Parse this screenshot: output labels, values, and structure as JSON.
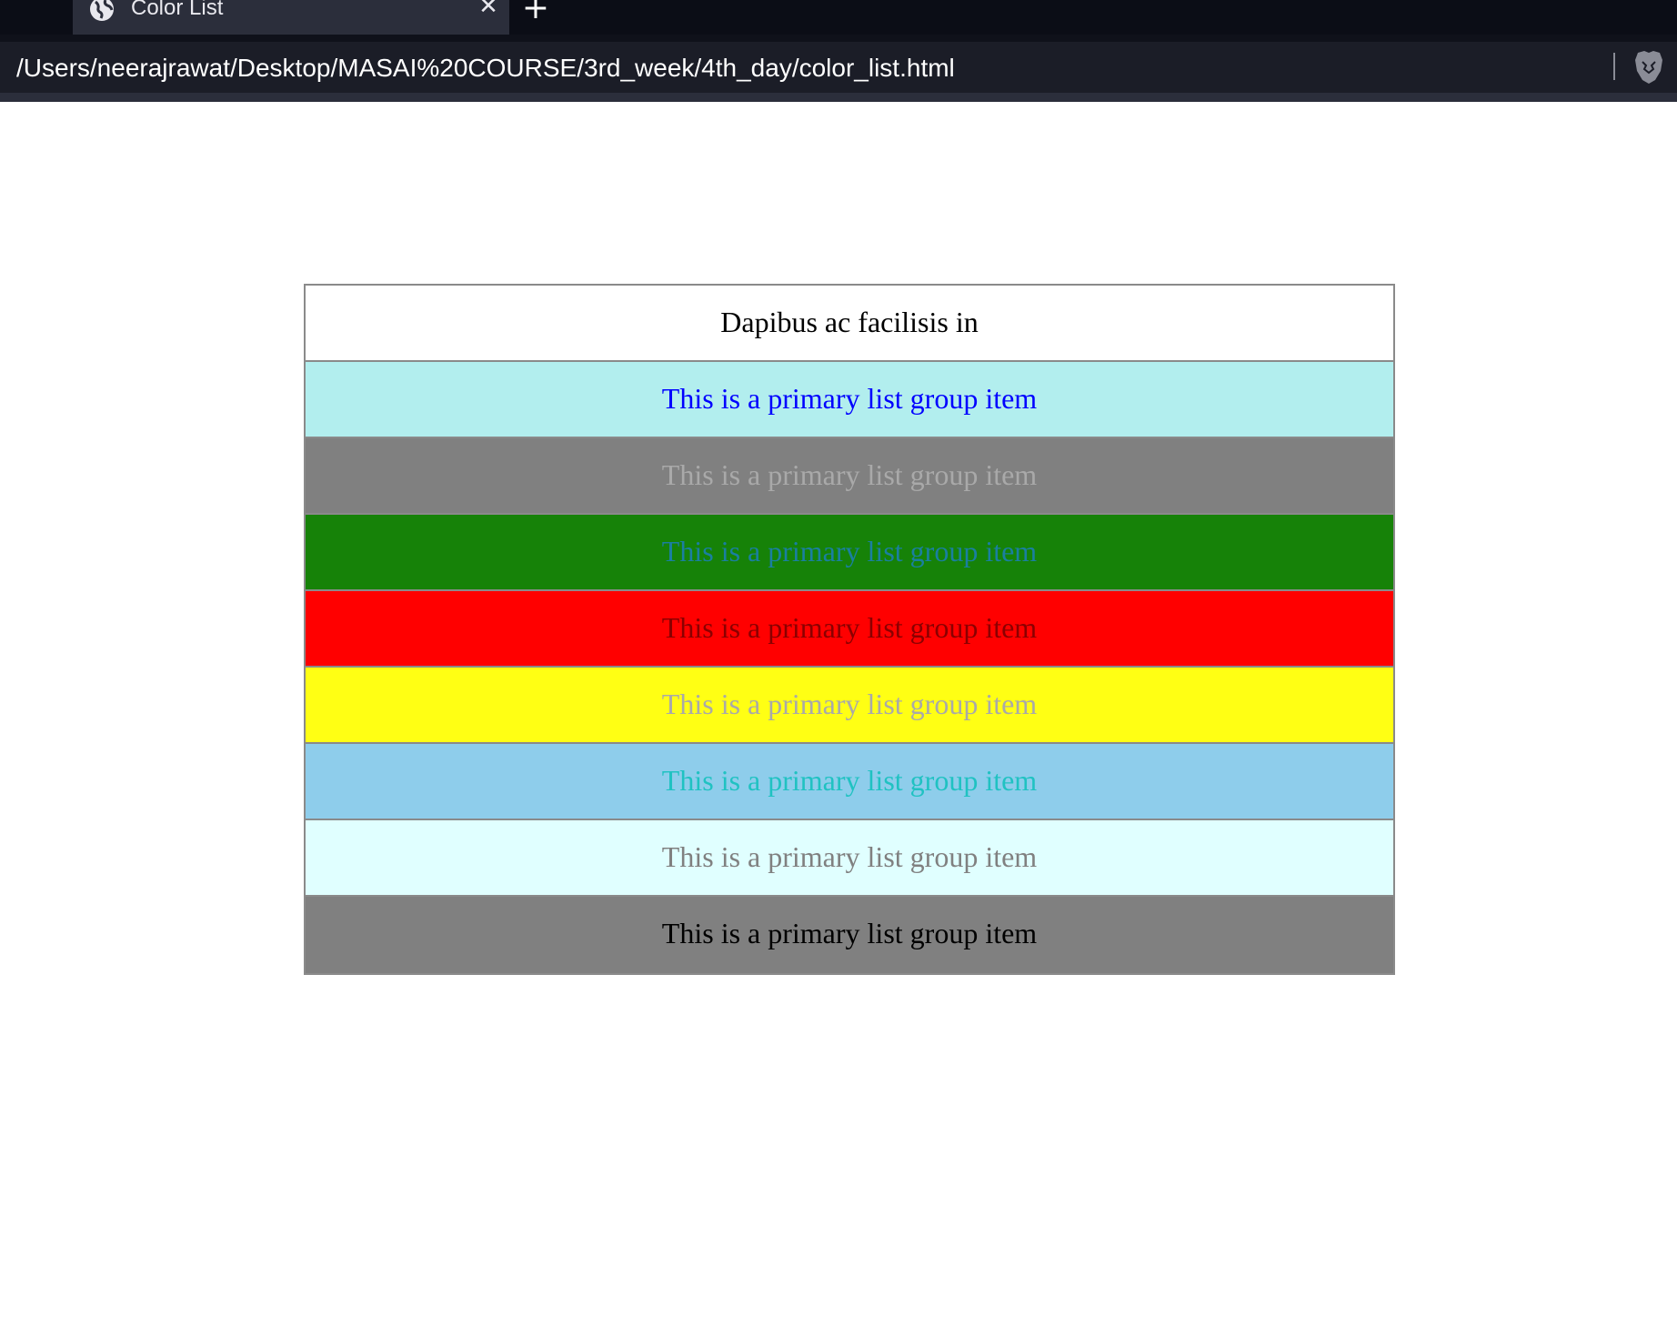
{
  "browser": {
    "tab_title": "Color List",
    "close_symbol": "✕",
    "new_tab_symbol": "+",
    "url": "/Users/neerajrawat/Desktop/MASAI%20COURSE/3rd_week/4th_day/color_list.html",
    "icons": [
      "globe-icon",
      "close-icon",
      "plus-icon",
      "brave-lion-icon"
    ]
  },
  "list": {
    "header": {
      "text": "Dapibus ac facilisis in",
      "bg": "#ffffff",
      "color": "#000000"
    },
    "items": [
      {
        "text": "This is a primary list group item",
        "bg": "#b2eeee",
        "color": "#0000ff"
      },
      {
        "text": "This is a primary list group item",
        "bg": "#808080",
        "color": "#a9a9a9"
      },
      {
        "text": "This is a primary list group item",
        "bg": "#168208",
        "color": "#1a7fa0"
      },
      {
        "text": "This is a primary list group item",
        "bg": "#ff0000",
        "color": "#8b0000"
      },
      {
        "text": "This is a primary list group item",
        "bg": "#ffff14",
        "color": "#a9a9a9"
      },
      {
        "text": "This is a primary list group item",
        "bg": "#8ecdeb",
        "color": "#20c2c2"
      },
      {
        "text": "This is a primary list group item",
        "bg": "#e0ffff",
        "color": "#808080"
      },
      {
        "text": "This is a primary list group item",
        "bg": "#808080",
        "color": "#000000"
      }
    ]
  }
}
